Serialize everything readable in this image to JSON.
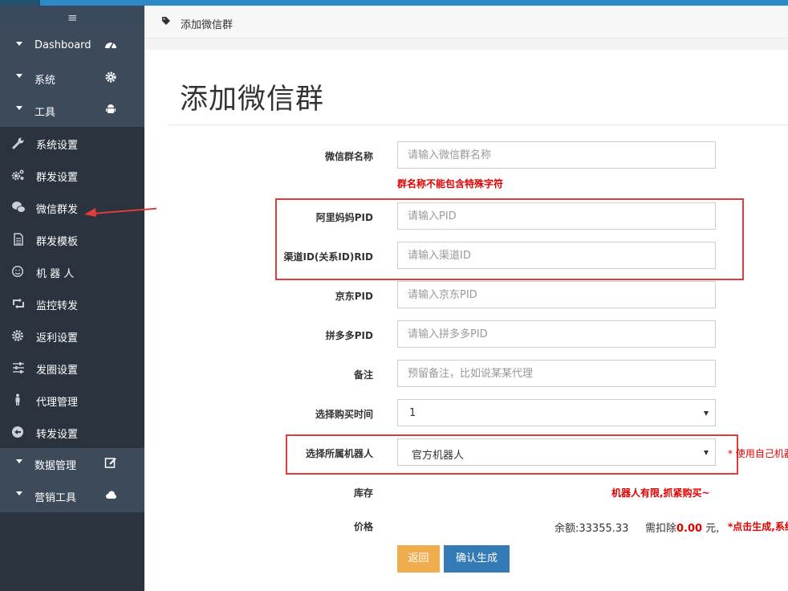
{
  "colors": {
    "accent": "#2c8ac6",
    "sidebar": "#2b333f",
    "sidebar_group": "#3d4a5a",
    "danger": "#e00000",
    "btn_warning": "#f0ad4e",
    "btn_primary": "#337ab7",
    "highlight_box": "#e03c3c"
  },
  "sidebar": {
    "toggle_icon": "hamburger-icon",
    "groups_top": [
      {
        "label": "Dashboard",
        "icon": "dashboard-icon"
      },
      {
        "label": "系统",
        "icon": "gear-icon"
      },
      {
        "label": "工具",
        "icon": "android-icon"
      }
    ],
    "items": [
      {
        "label": "系统设置",
        "icon": "wrench-icon"
      },
      {
        "label": "群发设置",
        "icon": "gears-icon"
      },
      {
        "label": "微信群发",
        "icon": "wechat-icon"
      },
      {
        "label": "群发模板",
        "icon": "file-icon"
      },
      {
        "label": "机 器 人",
        "icon": "smile-icon"
      },
      {
        "label": "监控转发",
        "icon": "retweet-icon"
      },
      {
        "label": "返利设置",
        "icon": "gear-icon"
      },
      {
        "label": "发圈设置",
        "icon": "sliders-icon"
      },
      {
        "label": "代理管理",
        "icon": "person-icon"
      },
      {
        "label": "转发设置",
        "icon": "share-icon"
      }
    ],
    "groups_bottom": [
      {
        "label": "数据管理",
        "icon": "edit-icon"
      },
      {
        "label": "营销工具",
        "icon": "cloud-icon"
      }
    ]
  },
  "breadcrumb": {
    "icon": "tag-icon",
    "text": "添加微信群"
  },
  "page": {
    "title": "添加微信群"
  },
  "form": {
    "group_name": {
      "label": "微信群名称",
      "placeholder": "请输入微信群名称",
      "hint": "群名称不能包含特殊字符"
    },
    "alimama_pid": {
      "label": "阿里妈妈PID",
      "placeholder": "请输入PID"
    },
    "channel_rid": {
      "label": "渠道ID(关系ID)RID",
      "placeholder": "请输入渠道ID"
    },
    "jd_pid": {
      "label": "京东PID",
      "placeholder": "请输入京东PID"
    },
    "pdd_pid": {
      "label": "拼多多PID",
      "placeholder": "请输入拼多多PID"
    },
    "remark": {
      "label": "备注",
      "placeholder": "预留备注，比如说某某代理"
    },
    "buy_time": {
      "label": "选择购买时间",
      "value": "1"
    },
    "robot": {
      "label": "选择所属机器人",
      "value": "官方机器人",
      "note": "* 使用自己机器"
    },
    "stock": {
      "label": "库存",
      "value": "机器人有限,抓紧购买~"
    },
    "price": {
      "label": "价格",
      "balance_label": "余额:33355.33",
      "deduct_prefix": "需扣除",
      "deduct_amount": "0.00",
      "deduct_suffix": "元,",
      "note": "*点击生成,系统"
    }
  },
  "buttons": {
    "back": "返回",
    "confirm": "确认生成"
  }
}
